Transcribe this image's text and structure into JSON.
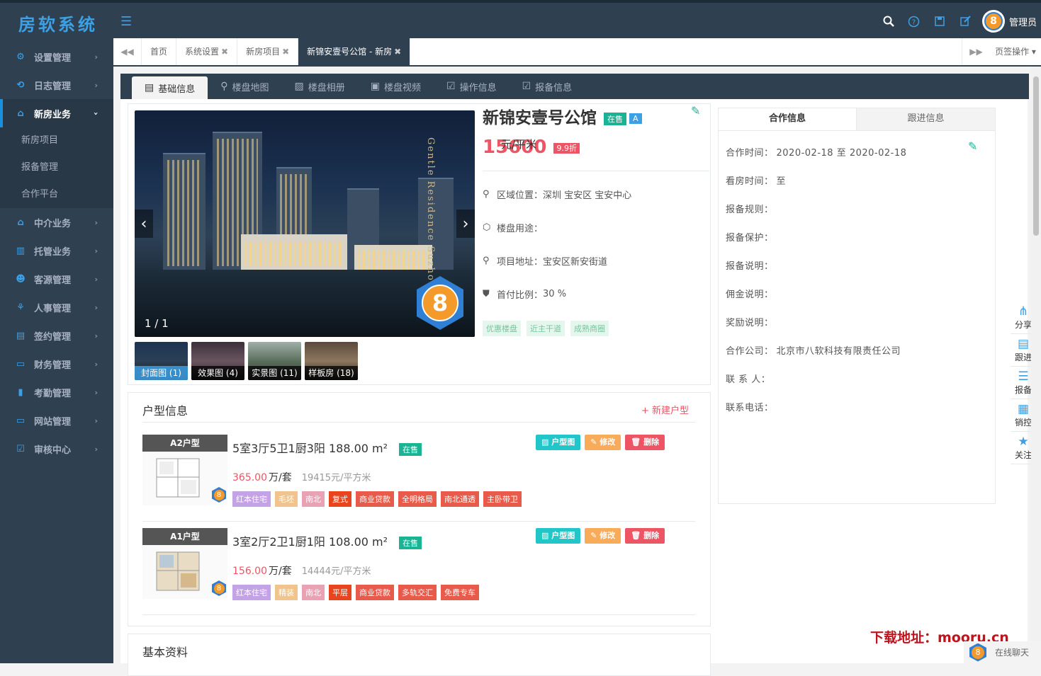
{
  "app": {
    "logo": "房软系统"
  },
  "header": {
    "username": "管理员",
    "avatar_glyph": "8"
  },
  "sidebar": {
    "items": [
      {
        "label": "设置管理",
        "icon": "gear-icon"
      },
      {
        "label": "日志管理",
        "icon": "log-icon"
      },
      {
        "label": "新房业务",
        "icon": "home-icon",
        "expanded": true,
        "children": [
          "新房项目",
          "报备管理",
          "合作平台"
        ]
      },
      {
        "label": "中介业务",
        "icon": "house-icon"
      },
      {
        "label": "托管业务",
        "icon": "building-icon"
      },
      {
        "label": "客源管理",
        "icon": "users-icon"
      },
      {
        "label": "人事管理",
        "icon": "org-icon"
      },
      {
        "label": "签约管理",
        "icon": "contract-icon"
      },
      {
        "label": "财务管理",
        "icon": "wallet-icon"
      },
      {
        "label": "考勤管理",
        "icon": "chart-icon"
      },
      {
        "label": "网站管理",
        "icon": "monitor-icon"
      },
      {
        "label": "审核中心",
        "icon": "check-icon"
      }
    ]
  },
  "tabs": {
    "items": [
      {
        "label": "首页",
        "closable": false
      },
      {
        "label": "系统设置",
        "closable": true
      },
      {
        "label": "新房项目",
        "closable": true
      },
      {
        "label": "新锦安壹号公馆 - 新房",
        "closable": true,
        "active": true
      }
    ],
    "page_ops": "页签操作"
  },
  "subtabs": [
    "基础信息",
    "楼盘地图",
    "楼盘相册",
    "楼盘视频",
    "操作信息",
    "报备信息"
  ],
  "project": {
    "name": "新锦安壹号公馆",
    "status": "在售",
    "grade": "A",
    "price": "15600",
    "price_unit": "元/平米",
    "discount": "9.9折",
    "region_label": "区域位置：",
    "region": "深圳 宝安区 宝安中心",
    "usage_label": "楼盘用途：",
    "usage": "",
    "address_label": "项目地址：",
    "address": "宝安区新安街道",
    "down_label": "首付比例：",
    "down": "30 %",
    "features": [
      "优惠楼盘",
      "近主干道",
      "成熟商圈"
    ],
    "gallery_count": "1 / 1",
    "gallery_text": "Gentle Residence Suzhou",
    "thumbs": [
      "封面图 (1)",
      "效果图 (4)",
      "实景图 (11)",
      "样板房 (18)"
    ]
  },
  "coop": {
    "tabs": [
      "合作信息",
      "跟进信息"
    ],
    "rows": [
      {
        "label": "合作时间：",
        "value": "2020-02-18 至 2020-02-18"
      },
      {
        "label": "看房时间：",
        "value": "至"
      },
      {
        "label": "报备规则：",
        "value": ""
      },
      {
        "label": "报备保护：",
        "value": ""
      },
      {
        "label": "报备说明：",
        "value": ""
      },
      {
        "label": "佣金说明：",
        "value": ""
      },
      {
        "label": "奖励说明：",
        "value": ""
      },
      {
        "label": "合作公司：",
        "value": "北京市八软科技有限责任公司"
      },
      {
        "label": "联 系 人：",
        "value": ""
      },
      {
        "label": "联系电话：",
        "value": ""
      }
    ]
  },
  "side_actions": [
    "分享",
    "跟进",
    "报备",
    "销控",
    "关注"
  ],
  "units": {
    "title": "户型信息",
    "new_label": "+ 新建户型",
    "buttons": [
      "户型图",
      "修改",
      "删除"
    ],
    "items": [
      {
        "label": "A2户型",
        "desc": "5室3厅5卫1厨3阳 188.00 m²",
        "status": "在售",
        "total": "365.00",
        "total_unit": "万/套",
        "per": "19415元/平方米",
        "tags": [
          {
            "text": "红本住宅",
            "color": "#c3a2e6"
          },
          {
            "text": "毛坯",
            "color": "#f0c48c"
          },
          {
            "text": "南北",
            "color": "#e9a2b4"
          },
          {
            "text": "复式",
            "color": "#e8441e"
          },
          {
            "text": "商业贷款",
            "color": "#e85a4a"
          },
          {
            "text": "全明格局",
            "color": "#e85a4a"
          },
          {
            "text": "南北通透",
            "color": "#e85a4a"
          },
          {
            "text": "主卧带卫",
            "color": "#e85a4a"
          }
        ]
      },
      {
        "label": "A1户型",
        "desc": "3室2厅2卫1厨1阳 108.00 m²",
        "status": "在售",
        "total": "156.00",
        "total_unit": "万/套",
        "per": "14444元/平方米",
        "tags": [
          {
            "text": "红本住宅",
            "color": "#c3a2e6"
          },
          {
            "text": "精装",
            "color": "#f0c48c"
          },
          {
            "text": "南北",
            "color": "#e9a2b4"
          },
          {
            "text": "平层",
            "color": "#e8441e"
          },
          {
            "text": "商业贷款",
            "color": "#e85a4a"
          },
          {
            "text": "多轨交汇",
            "color": "#e85a4a"
          },
          {
            "text": "免费专车",
            "color": "#e85a4a"
          }
        ]
      }
    ]
  },
  "basic": {
    "title": "基本资料"
  },
  "footer": {
    "download": "下载地址：mooru.cn",
    "chat": "在线聊天"
  },
  "colors": {
    "sidebar": "#2f4050",
    "accent": "#3ea0e4",
    "price": "#ed5565",
    "success": "#1ab394",
    "warning": "#f8ac59"
  }
}
